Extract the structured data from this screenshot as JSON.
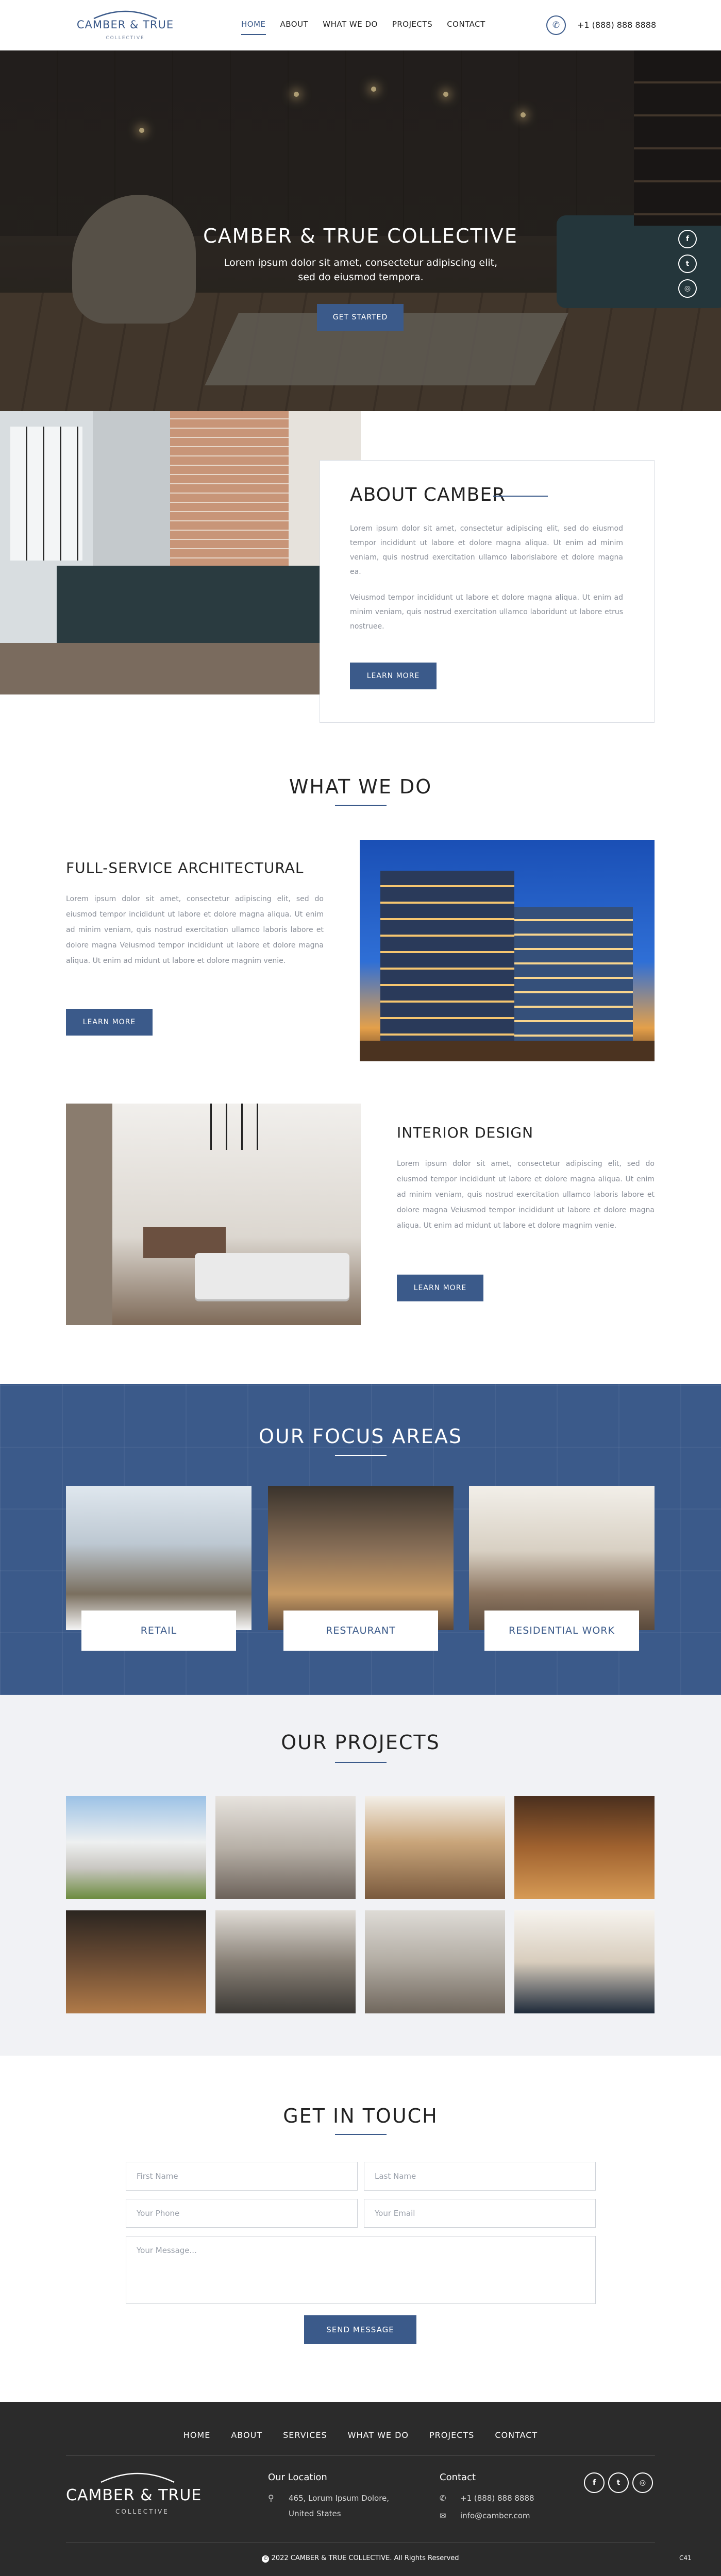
{
  "header": {
    "logo_main": "CAMBER & TRUE",
    "logo_sub": "COLLECTIVE",
    "nav": [
      "HOME",
      "ABOUT",
      "WHAT WE DO",
      "PROJECTS",
      "CONTACT"
    ],
    "active_nav": "HOME",
    "phone_icon": "phone-icon",
    "phone": "+1 (888) 888 8888"
  },
  "hero": {
    "title": "CAMBER & TRUE COLLECTIVE",
    "subtitle": "Lorem ipsum dolor sit amet, consectetur adipiscing elit, sed do eiusmod tempora.",
    "cta": "GET STARTED",
    "slides_total": 4,
    "slide_active": 2,
    "social_icons": [
      "facebook-icon",
      "twitter-icon",
      "instagram-icon"
    ]
  },
  "about": {
    "title": "ABOUT CAMBER",
    "p1": "Lorem ipsum dolor sit amet, consectetur adipiscing elit, sed do eiusmod tempor incididunt ut labore et dolore magna aliqua. Ut enim ad minim veniam, quis nostrud exercitation ullamco laborislabore et dolore magna ea.",
    "p2": "Veiusmod tempor incididunt ut labore et dolore magna aliqua. Ut enim ad minim veniam, quis nostrud exercitation ullamco laboridunt ut labore etrus nostruee.",
    "button": "LEARN MORE"
  },
  "what_we_do": {
    "title": "WHAT WE DO",
    "services": [
      {
        "title": "FULL-SERVICE ARCHITECTURAL",
        "text": "Lorem ipsum dolor sit amet, consectetur adipiscing elit, sed do eiusmod tempor incididunt ut labore et dolore magna aliqua. Ut enim ad minim veniam, quis nostrud exercitation ullamco laboris labore et dolore magna Veiusmod tempor incididunt ut labore et dolore magna aliqua. Ut enim ad midunt ut labore et dolore magnim venie.",
        "button": "LEARN MORE"
      },
      {
        "title": "INTERIOR DESIGN",
        "text": "Lorem ipsum dolor sit amet, consectetur adipiscing elit, sed do eiusmod tempor incididunt ut labore et dolore magna aliqua. Ut enim ad minim veniam, quis nostrud exercitation ullamco laboris labore et dolore magna Veiusmod tempor incididunt ut labore et dolore magna aliqua. Ut enim ad midunt ut labore et dolore magnim venie.",
        "button": "LEARN MORE"
      }
    ]
  },
  "focus": {
    "title": "OUR FOCUS AREAS",
    "areas": [
      "RETAIL",
      "RESTAURANT",
      "RESIDENTIAL WORK"
    ]
  },
  "projects": {
    "title": "OUR PROJECTS",
    "count": 8
  },
  "contact": {
    "title": "GET IN TOUCH",
    "first_name": "First Name",
    "last_name": "Last Name",
    "phone": "Your Phone",
    "email": "Your Email",
    "message": "Your Message...",
    "button": "SEND MESSAGE"
  },
  "footer": {
    "nav": [
      "HOME",
      "ABOUT",
      "SERVICES",
      "WHAT WE DO",
      "PROJECTS",
      "CONTACT"
    ],
    "logo_main": "CAMBER & TRUE",
    "logo_sub": "COLLECTIVE",
    "location_title": "Our Location",
    "address_line1": "465, Lorum Ipsum Dolore,",
    "address_line2": "United States",
    "contact_title": "Contact",
    "phone": "+1 (888) 888 8888",
    "email": "info@camber.com",
    "social_icons": [
      "facebook-icon",
      "twitter-icon",
      "instagram-icon"
    ],
    "copyright": "2022 CAMBER & TRUE COLLECTIVE. All Rights Reserved",
    "corner": "C41"
  },
  "colors": {
    "accent": "#3b5a8a",
    "footer_bg": "#2b2b2b",
    "projects_bg": "#f1f2f5"
  }
}
